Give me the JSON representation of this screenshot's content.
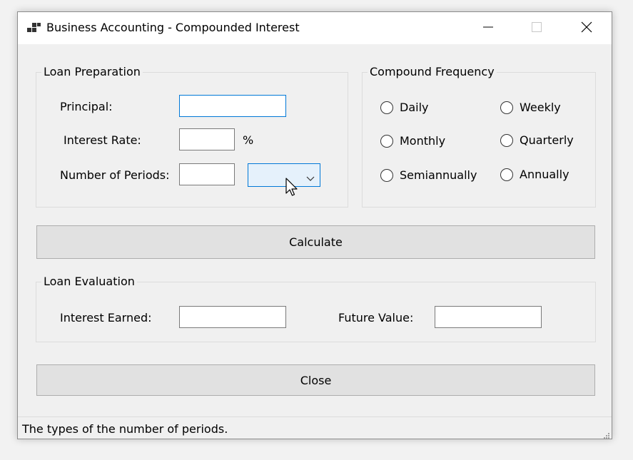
{
  "window": {
    "title": "Business Accounting - Compounded Interest"
  },
  "loan_preparation": {
    "title": "Loan Preparation",
    "principal_label": "Principal:",
    "principal_value": "",
    "interest_rate_label": "Interest Rate:",
    "interest_rate_value": "",
    "percent_sign": "%",
    "periods_label": "Number of Periods:",
    "periods_value": "",
    "period_type_selected": ""
  },
  "compound_frequency": {
    "title": "Compound Frequency",
    "options": [
      {
        "label": "Daily",
        "checked": false
      },
      {
        "label": "Weekly",
        "checked": false
      },
      {
        "label": "Monthly",
        "checked": false
      },
      {
        "label": "Quarterly",
        "checked": false
      },
      {
        "label": "Semiannually",
        "checked": false
      },
      {
        "label": "Annually",
        "checked": false
      }
    ]
  },
  "calculate_label": "Calculate",
  "loan_evaluation": {
    "title": "Loan Evaluation",
    "interest_earned_label": "Interest Earned:",
    "interest_earned_value": "",
    "future_value_label": "Future Value:",
    "future_value_value": ""
  },
  "close_label": "Close",
  "status_text": "The types of the number of periods.",
  "colors": {
    "accent": "#0078d7",
    "combo_background": "#e5f1fb",
    "button_background": "#e1e1e1",
    "window_background": "#f0f0f0"
  },
  "icons": [
    "app-icon",
    "minimize-icon",
    "maximize-icon",
    "close-icon",
    "chevron-down-icon",
    "mouse-pointer-icon",
    "size-grip-icon"
  ]
}
